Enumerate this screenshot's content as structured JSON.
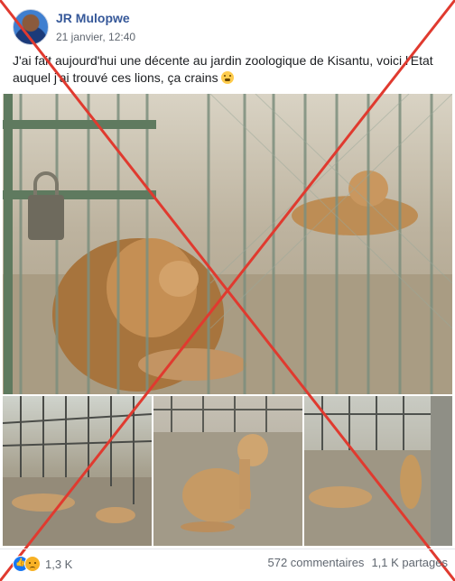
{
  "post": {
    "author": "JR Mulopwe",
    "date": "21 janvier, 12:40",
    "text": "J'ai fait aujourd'hui une décente au jardin zoologique de Kisantu, voici l'Etat auquel j'ai trouvé ces lions, ça crains"
  },
  "footer": {
    "reaction_count": "1,3 K",
    "comments": "572 commentaires",
    "shares": "1,1 K partages"
  },
  "colors": {
    "cross": "#e03a2f",
    "author_link": "#365899",
    "meta_gray": "#606770"
  },
  "icons": {
    "reactions": [
      "like-icon",
      "sad-icon"
    ],
    "post_emoji": "grimacing-face-icon"
  }
}
